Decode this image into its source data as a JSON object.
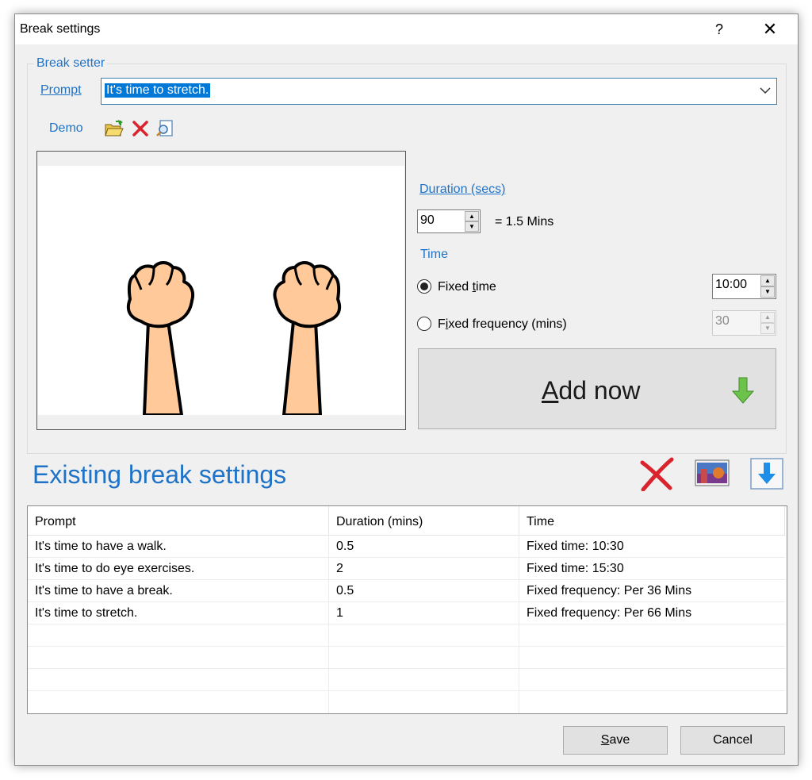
{
  "window": {
    "title": "Break settings",
    "help_glyph": "?",
    "close_glyph": "✕"
  },
  "break_setter": {
    "group_label": "Break setter",
    "prompt_label": "Prompt",
    "prompt_value": "It's time to stretch.",
    "demo_label": "Demo",
    "demo_icons": [
      "open-folder-icon",
      "delete-icon",
      "preview-search-icon"
    ],
    "image_icon": "raised-fists-symbol",
    "duration": {
      "label": "Duration (secs)",
      "value": "90",
      "equivalent": "= 1.5 Mins"
    },
    "time": {
      "label": "Time",
      "fixed_time_label_pre": "Fixed ",
      "fixed_time_label_accel": "t",
      "fixed_time_label_post": "ime",
      "fixed_time_value": "10:00",
      "fixed_time_checked": true,
      "fixed_freq_label_pre": "F",
      "fixed_freq_label_accel": "i",
      "fixed_freq_label_post": "xed frequency (mins)",
      "fixed_freq_value": "30",
      "fixed_freq_checked": false
    },
    "add_now": {
      "label_accel": "A",
      "label_rest": "dd now",
      "icon": "green-down-arrow-icon"
    }
  },
  "existing": {
    "title": "Existing break settings",
    "toolbar_icons": [
      "delete-red-x-icon",
      "image-thumbnail-icon",
      "download-arrow-icon"
    ],
    "columns": [
      "Prompt",
      "Duration (mins)",
      "Time"
    ],
    "rows": [
      {
        "prompt": "It's time to have a walk.",
        "duration": "0.5",
        "time": "Fixed time: 10:30"
      },
      {
        "prompt": "It's time to do eye exercises.",
        "duration": "2",
        "time": "Fixed time: 15:30"
      },
      {
        "prompt": "It's time to have a break.",
        "duration": "0.5",
        "time": "Fixed frequency: Per 36 Mins"
      },
      {
        "prompt": "It's time to stretch.",
        "duration": "1",
        "time": "Fixed frequency: Per 66 Mins"
      }
    ]
  },
  "footer": {
    "save_accel": "S",
    "save_rest": "ave",
    "cancel_label": "Cancel"
  },
  "colors": {
    "accent_blue": "#1e73c8",
    "selection_blue": "#0078d7",
    "arrow_green": "#6cc24a",
    "delete_red": "#d9232d",
    "skin": "#ffc99a"
  }
}
